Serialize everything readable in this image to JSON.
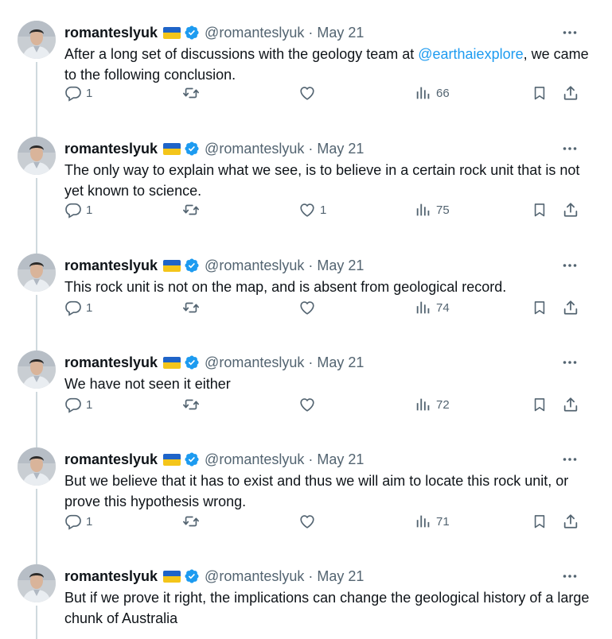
{
  "author": {
    "name": "romanteslyuk",
    "handle": "@romanteslyuk",
    "separator": "·",
    "flag_colors": [
      "#1f64c8",
      "#f4c51a"
    ],
    "verified_color": "#1d9bf0"
  },
  "accent": "#1d9bf0",
  "tweets": [
    {
      "date": "May 21",
      "text_before": "After a long set of discussions with the geology team at ",
      "mention": "@earthaiexplore",
      "text_after": ", we came to the following conclusion.",
      "replies": "1",
      "retweets": "",
      "likes": "",
      "views": "66"
    },
    {
      "date": "May 21",
      "text_before": "The only way to explain what we see, is to believe in a certain rock unit that is not yet known to science.",
      "mention": "",
      "text_after": "",
      "replies": "1",
      "retweets": "",
      "likes": "1",
      "views": "75"
    },
    {
      "date": "May 21",
      "text_before": "This rock unit is not on the map, and is absent from geological record.",
      "mention": "",
      "text_after": "",
      "replies": "1",
      "retweets": "",
      "likes": "",
      "views": "74"
    },
    {
      "date": "May 21",
      "text_before": "We have not seen it either",
      "mention": "",
      "text_after": "",
      "replies": "1",
      "retweets": "",
      "likes": "",
      "views": "72"
    },
    {
      "date": "May 21",
      "text_before": "But we believe that it has to exist and thus we will aim to locate this rock unit, or prove this hypothesis wrong.",
      "mention": "",
      "text_after": "",
      "replies": "1",
      "retweets": "",
      "likes": "",
      "views": "71"
    },
    {
      "date": "May 21",
      "text_before": "But if we prove it right, the implications can change the geological history of a large chunk of Australia",
      "mention": "",
      "text_after": "",
      "replies": "",
      "retweets": "",
      "likes": "",
      "views": "",
      "actions_visible": false
    }
  ]
}
